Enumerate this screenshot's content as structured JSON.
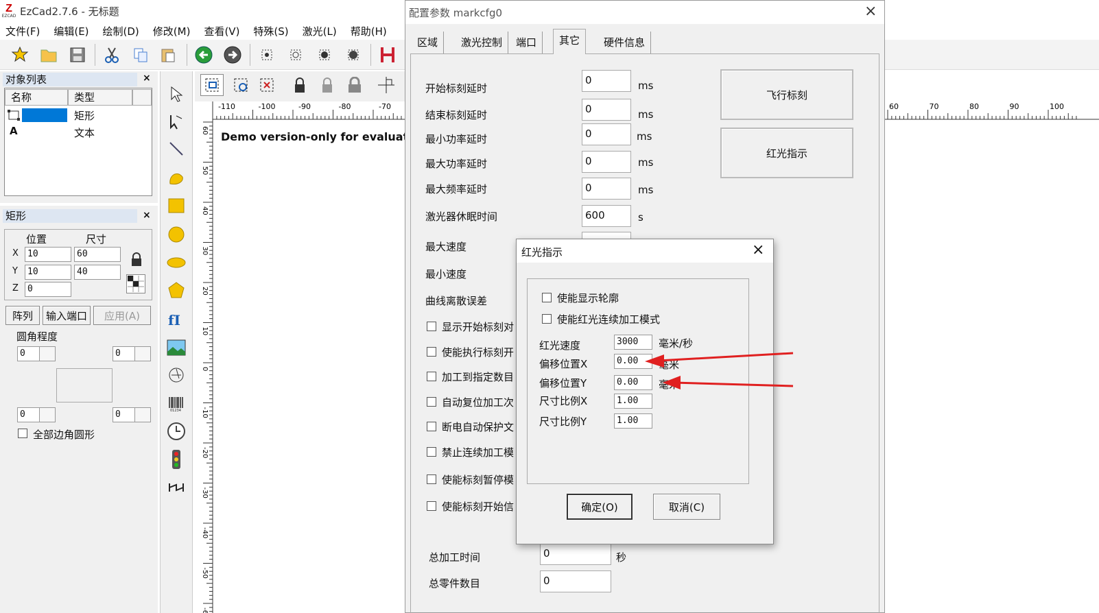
{
  "app": {
    "title": "EzCad2.7.6 - 无标题",
    "logo_small": "EZCAD"
  },
  "menu": [
    "文件(F)",
    "编辑(E)",
    "绘制(D)",
    "修改(M)",
    "查看(V)",
    "特殊(S)",
    "激光(L)",
    "帮助(H)"
  ],
  "object_list": {
    "title": "对象列表",
    "col_name": "名称",
    "col_type": "类型",
    "rows": [
      {
        "name": "",
        "type": "矩形",
        "icon": "rectangle-icon"
      },
      {
        "name": "A",
        "type": "文本",
        "icon": "text-icon"
      }
    ]
  },
  "props": {
    "title": "矩形",
    "pos_label": "位置",
    "size_label": "尺寸",
    "x_label": "X",
    "y_label": "Y",
    "z_label": "Z",
    "x": "10",
    "y": "10",
    "z": "0",
    "w": "60",
    "h": "40",
    "btn_array": "阵列",
    "btn_input_port": "输入端口",
    "btn_apply": "应用(A)",
    "round_label": "圆角程度",
    "corner_tl": "0",
    "corner_tr": "0",
    "corner_bl": "0",
    "corner_br": "0",
    "all_corners_label": "全部边角圆形"
  },
  "canvas": {
    "demo_text": "Demo version-only for evaluati",
    "hruler_left": [
      "-110",
      "-100",
      "-90",
      "-80",
      "-70"
    ],
    "hruler_right": [
      "60",
      "70",
      "80",
      "90",
      "100"
    ],
    "vruler": [
      "60",
      "50",
      "40",
      "30",
      "20",
      "10",
      "0",
      "-10",
      "-20",
      "-30",
      "-40",
      "-50",
      "-60"
    ]
  },
  "config": {
    "title": "配置参数 markcfg0",
    "tabs": [
      "区域",
      "激光控制",
      "端口",
      "其它",
      "硬件信息"
    ],
    "active_tab": "其它",
    "rows": [
      {
        "label": "开始标刻延时",
        "value": "0",
        "unit": "ms"
      },
      {
        "label": "结束标刻延时",
        "value": "0",
        "unit": "ms"
      },
      {
        "label": "最小功率延时",
        "value": "0",
        "unit": "ms"
      },
      {
        "label": "最大功率延时",
        "value": "0",
        "unit": "ms"
      },
      {
        "label": "最大频率延时",
        "value": "0",
        "unit": "ms"
      },
      {
        "label": "激光器休眠时间",
        "value": "600",
        "unit": "s"
      }
    ],
    "max_speed_label": "最大速度",
    "min_speed_label": "最小速度",
    "curve_label": "曲线离散误差",
    "checkboxes": [
      "显示开始标刻对",
      "使能执行标刻开",
      "加工到指定数目",
      "自动复位加工次",
      "断电自动保护文",
      "禁止连续加工模",
      "使能标刻暂停模",
      "使能标刻开始信"
    ],
    "fly_btn": "飞行标刻",
    "red_btn": "红光指示",
    "total_time_label": "总加工时间",
    "total_time_value": "0",
    "total_time_unit": "秒",
    "total_parts_label": "总零件数目",
    "total_parts_value": "0"
  },
  "red_dialog": {
    "title": "红光指示",
    "chk1": "使能显示轮廓",
    "chk2": "使能红光连续加工模式",
    "speed_label": "红光速度",
    "speed_value": "3000",
    "speed_unit": "毫米/秒",
    "offx_label": "偏移位置X",
    "offx_value": "0.00",
    "offx_unit": "毫米",
    "offy_label": "偏移位置Y",
    "offy_value": "0.00",
    "offy_unit": "毫米",
    "scalex_label": "尺寸比例X",
    "scalex_value": "1.00",
    "scaley_label": "尺寸比例Y",
    "scaley_value": "1.00",
    "ok": "确定(O)",
    "cancel": "取消(C)"
  },
  "colors": {
    "accent": "#0078d7",
    "arrow": "#e02020",
    "panel_title": "#dde6f2"
  }
}
